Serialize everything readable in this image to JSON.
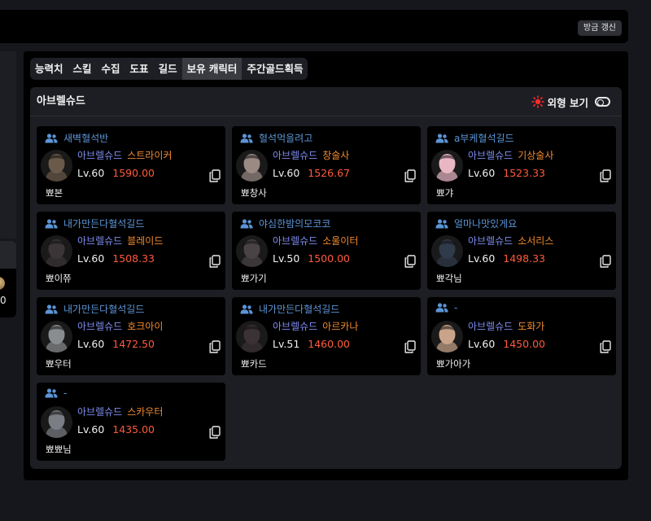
{
  "top_bar": {
    "refresh_label": "방금 갱신"
  },
  "left_card": {
    "digit": "0"
  },
  "tabs": [
    {
      "label": "능력치",
      "active": false
    },
    {
      "label": "스킬",
      "active": false
    },
    {
      "label": "수집",
      "active": false
    },
    {
      "label": "도표",
      "active": false
    },
    {
      "label": "길드",
      "active": false
    },
    {
      "label": "보유 캐릭터",
      "active": true
    },
    {
      "label": "주간골드획득",
      "active": false
    }
  ],
  "section": {
    "server": "아브렐슈드",
    "appearance_label": "외형 보기",
    "appearance_icon": "sun-icon",
    "accent_color": "#ff2a2a"
  },
  "colors": {
    "guild": "#5b95d6",
    "server": "#7f8df0",
    "class": "#f08a2e",
    "item_level": "#ff5a3c"
  },
  "characters": [
    {
      "guild": "새벽혈석반",
      "server": "아브렐슈드",
      "class": "스트라이커",
      "level": "Lv.60",
      "item_level": "1590.00",
      "name": "뾰본",
      "avatar_tone": "#6b5a4a"
    },
    {
      "guild": "혈석먹을려고",
      "server": "아브렐슈드",
      "class": "창술사",
      "level": "Lv.60",
      "item_level": "1526.67",
      "name": "뾰창사",
      "avatar_tone": "#9a8a84"
    },
    {
      "guild": "a부케혈석길드",
      "server": "아브렐슈드",
      "class": "기상술사",
      "level": "Lv.60",
      "item_level": "1523.33",
      "name": "뾰갸",
      "avatar_tone": "#e9b7c4"
    },
    {
      "guild": "내가만든다혈석길드",
      "server": "아브렐슈드",
      "class": "블레이드",
      "level": "Lv.60",
      "item_level": "1508.33",
      "name": "뾰이쮸",
      "avatar_tone": "#3b3537"
    },
    {
      "guild": "야심한밤의모코코",
      "server": "아브렐슈드",
      "class": "소울이터",
      "level": "Lv.50",
      "item_level": "1500.00",
      "name": "뾰가기",
      "avatar_tone": "#4a4346"
    },
    {
      "guild": "얼마나맛있게요",
      "server": "아브렐슈드",
      "class": "소서리스",
      "level": "Lv.60",
      "item_level": "1498.33",
      "name": "뾰각님",
      "avatar_tone": "#2f3a4a"
    },
    {
      "guild": "내가만든다혈석길드",
      "server": "아브렐슈드",
      "class": "호크아이",
      "level": "Lv.60",
      "item_level": "1472.50",
      "name": "뾰우터",
      "avatar_tone": "#8a8d90"
    },
    {
      "guild": "내가만든다혈석길드",
      "server": "아브렐슈드",
      "class": "아르카나",
      "level": "Lv.51",
      "item_level": "1460.00",
      "name": "뾰카드",
      "avatar_tone": "#3a3234"
    },
    {
      "guild": "-",
      "server": "아브렐슈드",
      "class": "도화가",
      "level": "Lv.60",
      "item_level": "1450.00",
      "name": "뾰가아가",
      "avatar_tone": "#c9a48a"
    },
    {
      "guild": "-",
      "server": "아브렐슈드",
      "class": "스카우터",
      "level": "Lv.60",
      "item_level": "1435.00",
      "name": "뾰뾰님",
      "avatar_tone": "#7a7d84"
    }
  ]
}
